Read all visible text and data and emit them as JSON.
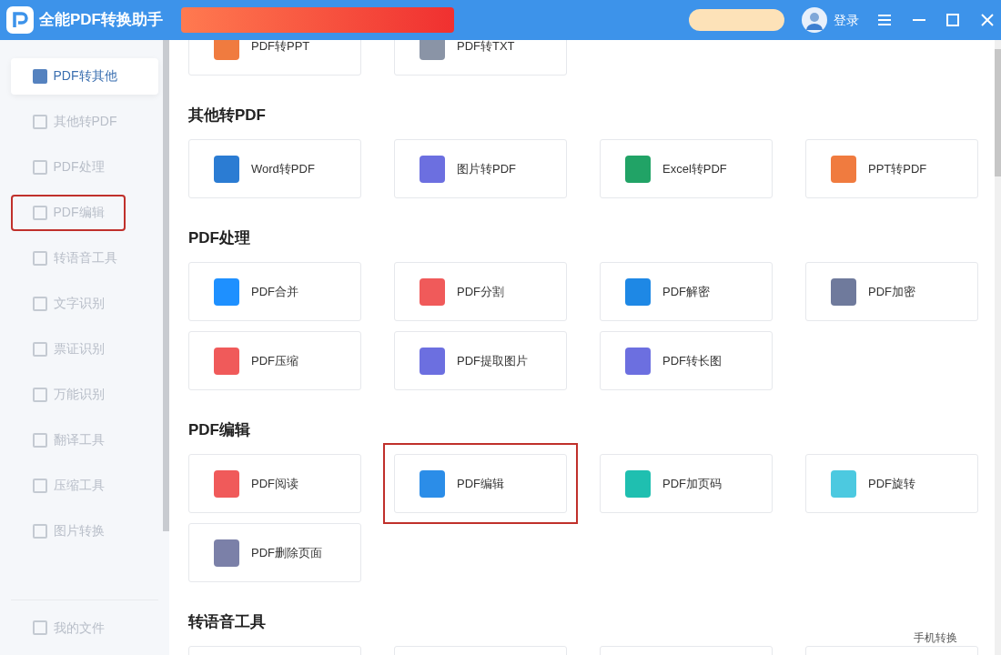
{
  "window": {
    "title": "全能PDF转换助手",
    "login": "登录"
  },
  "sidebar": {
    "items": [
      {
        "label": "PDF转其他",
        "selected": true,
        "highlighted": false
      },
      {
        "label": "其他转PDF",
        "selected": false,
        "highlighted": false
      },
      {
        "label": "PDF处理",
        "selected": false,
        "highlighted": false
      },
      {
        "label": "PDF编辑",
        "selected": false,
        "highlighted": true
      },
      {
        "label": "转语音工具",
        "selected": false,
        "highlighted": false
      },
      {
        "label": "文字识别",
        "selected": false,
        "highlighted": false
      },
      {
        "label": "票证识别",
        "selected": false,
        "highlighted": false
      },
      {
        "label": "万能识别",
        "selected": false,
        "highlighted": false
      },
      {
        "label": "翻译工具",
        "selected": false,
        "highlighted": false
      },
      {
        "label": "压缩工具",
        "selected": false,
        "highlighted": false
      },
      {
        "label": "图片转换",
        "selected": false,
        "highlighted": false
      }
    ],
    "footer": "我的文件"
  },
  "sections": [
    {
      "tools": [
        {
          "label": "PDF转PPT",
          "color": "#f07b3f",
          "highlighted": false
        },
        {
          "label": "PDF转TXT",
          "color": "#8a94a6",
          "highlighted": false
        }
      ]
    },
    {
      "title": "其他转PDF",
      "tools": [
        {
          "label": "Word转PDF",
          "color": "#2b7cd3",
          "highlighted": false
        },
        {
          "label": "图片转PDF",
          "color": "#6c6fe0",
          "highlighted": false
        },
        {
          "label": "Excel转PDF",
          "color": "#21a366",
          "highlighted": false
        },
        {
          "label": "PPT转PDF",
          "color": "#f07b3f",
          "highlighted": false
        }
      ]
    },
    {
      "title": "PDF处理",
      "tools": [
        {
          "label": "PDF合并",
          "color": "#1e90ff",
          "highlighted": false
        },
        {
          "label": "PDF分割",
          "color": "#f05a5a",
          "highlighted": false
        },
        {
          "label": "PDF解密",
          "color": "#1e88e5",
          "highlighted": false
        },
        {
          "label": "PDF加密",
          "color": "#6f7a9c",
          "highlighted": false
        },
        {
          "label": "PDF压缩",
          "color": "#f05a5a",
          "highlighted": false
        },
        {
          "label": "PDF提取图片",
          "color": "#6c6fe0",
          "highlighted": false
        },
        {
          "label": "PDF转长图",
          "color": "#6c6fe0",
          "highlighted": false
        }
      ]
    },
    {
      "title": "PDF编辑",
      "tools": [
        {
          "label": "PDF阅读",
          "color": "#f05a5a",
          "highlighted": false
        },
        {
          "label": "PDF编辑",
          "color": "#2b8de8",
          "highlighted": true
        },
        {
          "label": "PDF加页码",
          "color": "#1fbfb0",
          "highlighted": false
        },
        {
          "label": "PDF旋转",
          "color": "#4cc9e0",
          "highlighted": false
        },
        {
          "label": "PDF删除页面",
          "color": "#7b80a8",
          "highlighted": false
        }
      ]
    },
    {
      "title": "转语音工具"
    }
  ],
  "mobile_link": "手机转换"
}
